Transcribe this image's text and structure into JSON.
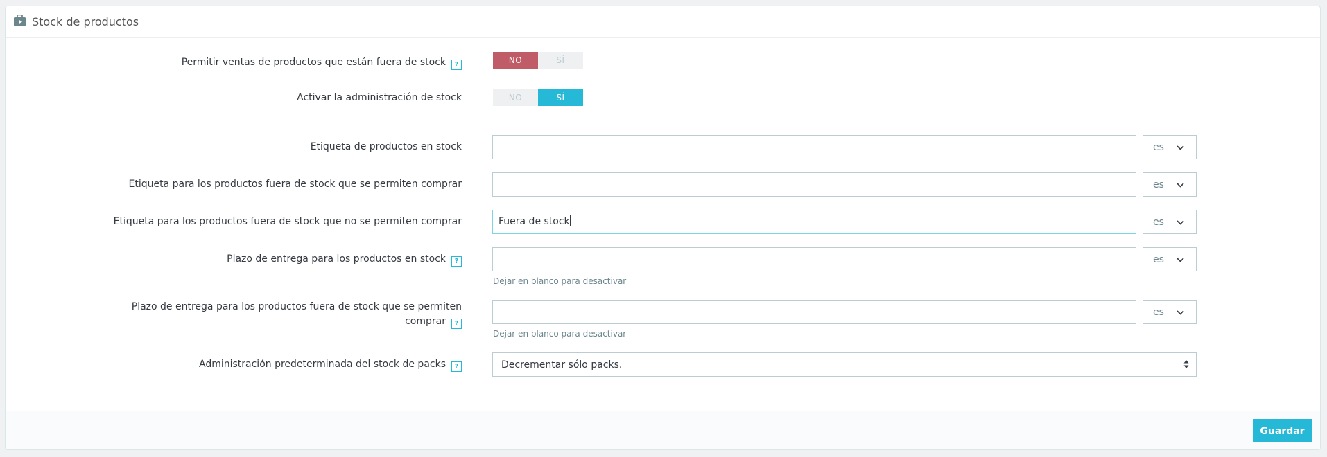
{
  "panel": {
    "title": "Stock de productos"
  },
  "fields": {
    "allow_oos_sales": {
      "label": "Permitir ventas de productos que están fuera de stock",
      "no": "NO",
      "yes": "SÍ",
      "value": "NO"
    },
    "stock_management": {
      "label": "Activar la administración de stock",
      "no": "NO",
      "yes": "SÍ",
      "value": "SÍ"
    },
    "label_in_stock": {
      "label": "Etiqueta de productos en stock",
      "value": "",
      "lang": "es"
    },
    "label_oos_allowed": {
      "label": "Etiqueta para los productos fuera de stock que se permiten comprar",
      "value": "",
      "lang": "es"
    },
    "label_oos_denied": {
      "label": "Etiqueta para los productos fuera de stock que no se permiten comprar",
      "value": "Fuera de stock",
      "lang": "es"
    },
    "delivery_in_stock": {
      "label": "Plazo de entrega para los productos en stock",
      "value": "",
      "lang": "es",
      "hint": "Dejar en blanco para desactivar"
    },
    "delivery_oos": {
      "label_line1": "Plazo de entrega para los productos fuera de stock que se permiten",
      "label_line2": "comprar",
      "value": "",
      "lang": "es",
      "hint": "Dejar en blanco para desactivar"
    },
    "pack_stock": {
      "label": "Administración predeterminada del stock de packs",
      "selected": "Decrementar sólo packs."
    }
  },
  "help_icon": "?",
  "footer": {
    "save_label": "Guardar"
  },
  "colors": {
    "accent": "#25b9d7",
    "danger": "#c05c67"
  }
}
